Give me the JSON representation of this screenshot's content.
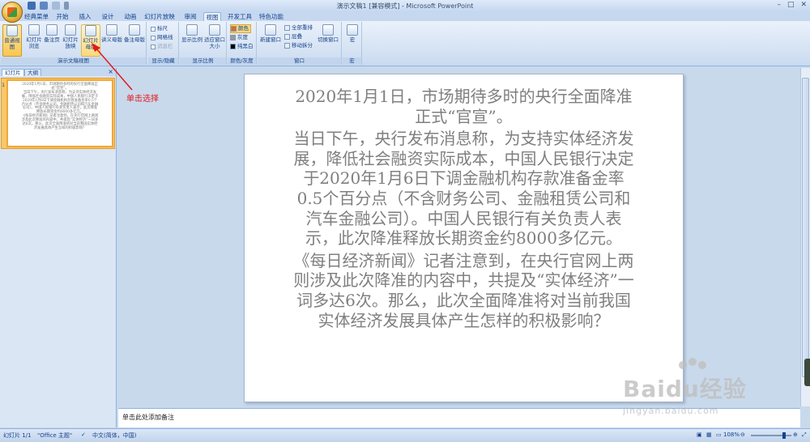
{
  "window": {
    "title": "演示文稿1 [兼容模式] - Microsoft PowerPoint",
    "controls": [
      "–",
      "□",
      "✕"
    ]
  },
  "tabs": [
    "经典菜单",
    "开始",
    "插入",
    "设计",
    "动画",
    "幻灯片放映",
    "审阅",
    "视图",
    "开发工具",
    "特色功能"
  ],
  "ribbon": {
    "group_views": {
      "label": "演示文稿视图",
      "buttons": [
        "普通视图",
        "幻灯片浏览",
        "备注页",
        "幻灯片放映",
        "幻灯片母版",
        "讲义母版",
        "备注母版"
      ]
    },
    "group_show": {
      "label": "显示/隐藏",
      "items": [
        "标尺",
        "网格线",
        "消息栏"
      ]
    },
    "group_zoom": {
      "label": "显示比例",
      "buttons": [
        "显示比例",
        "适应窗口大小"
      ]
    },
    "group_color": {
      "label": "颜色/灰度",
      "items": [
        "颜色",
        "灰度",
        "纯黑白"
      ]
    },
    "group_window": {
      "label": "窗口",
      "buttons": [
        "新建窗口",
        "切换窗口"
      ],
      "items": [
        "全部重排",
        "层叠",
        "移动拆分"
      ]
    },
    "group_macro": {
      "label": "宏",
      "buttons": [
        "宏"
      ]
    }
  },
  "left_pane": {
    "tabs": [
      "幻灯片",
      "大纲"
    ],
    "close": "×",
    "slide_number": "1",
    "thumbnail_text": [
      "2020年1月1日，市场期待多时的央行全面降准正式“官宣”。",
      "当日下午，央行发布消息称，为支持实体经济发展，降低社会融资实际成本，中国人民银行决定于2020年1月6日下调金融机构存款准备金率0.5个百分点（不含财务公司、金融租赁公司和汽车金融公司）。中国人民银行有关负责人表示，此次降准释放长期资金约8000多亿元。",
      "《每日经济新闻》记者注意到，在央行官网上两则涉及此次降准的内容中，共提及“实体经济”一词多达6次。那么，此次全面降准将对当前我国实体经济发展具体产生怎样的积极影响？"
    ]
  },
  "slide": {
    "paragraphs": [
      "2020年1月1日，市场期待多时的央行全面降准正式“官宣”。",
      "当日下午，央行发布消息称，为支持实体经济发展，降低社会融资实际成本，中国人民银行决定于2020年1月6日下调金融机构存款准备金率0.5个百分点（不含财务公司、金融租赁公司和汽车金融公司）。中国人民银行有关负责人表示，此次降准释放长期资金约8000多亿元。",
      "《每日经济新闻》记者注意到，在央行官网上两则涉及此次降准的内容中，共提及“实体经济”一词多达6次。那么，此次全面降准将对当前我国实体经济发展具体产生怎样的积极影响？"
    ]
  },
  "notes": {
    "placeholder": "单击此处添加备注"
  },
  "annotation": {
    "text": "单击选择",
    "color": "#e1191c"
  },
  "status_bar": {
    "slide_info": "幻灯片 1/1",
    "theme": "\"Office 主题\"",
    "language": "中文(简体，中国)",
    "zoom": "108%"
  },
  "watermark": {
    "brand": "Baidu经验",
    "url": "jingyan.baidu.com"
  },
  "colors": {
    "accent": "#15428b",
    "selected_button": "#f9c64f",
    "annotation": "#e1191c"
  }
}
